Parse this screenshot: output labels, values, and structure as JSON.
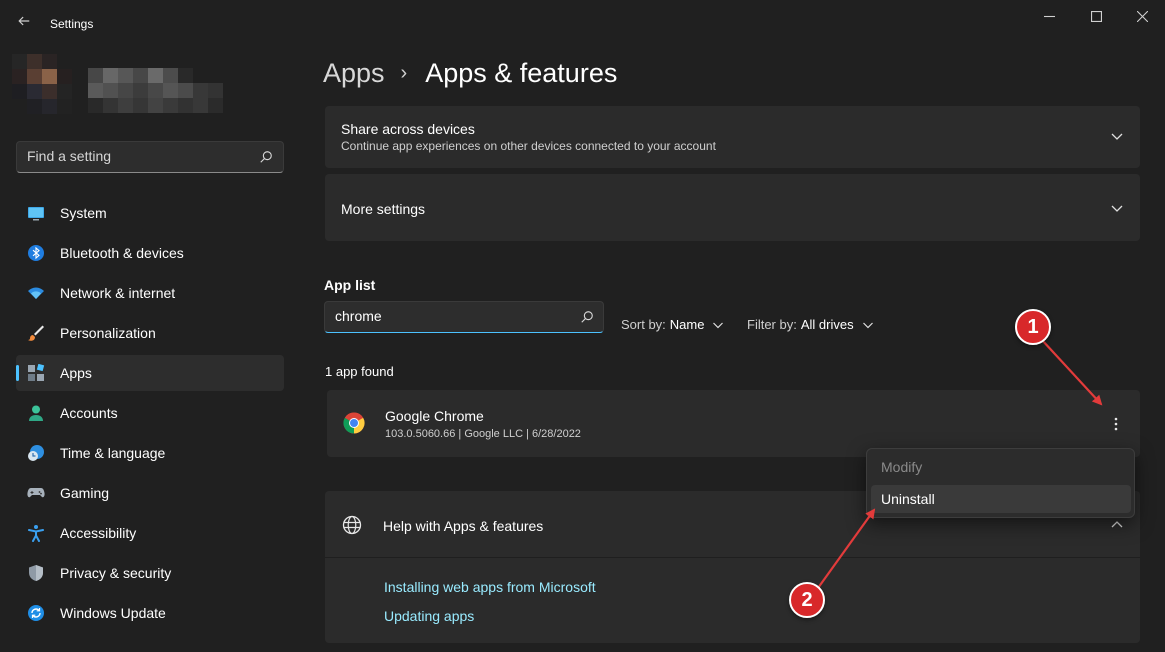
{
  "window": {
    "title": "Settings"
  },
  "search": {
    "placeholder": "Find a setting"
  },
  "sidebar": {
    "items": [
      {
        "label": "System",
        "icon": "monitor-icon"
      },
      {
        "label": "Bluetooth & devices",
        "icon": "bluetooth-icon"
      },
      {
        "label": "Network & internet",
        "icon": "wifi-icon"
      },
      {
        "label": "Personalization",
        "icon": "brush-icon"
      },
      {
        "label": "Apps",
        "icon": "apps-icon",
        "active": true
      },
      {
        "label": "Accounts",
        "icon": "person-icon"
      },
      {
        "label": "Time & language",
        "icon": "clock-globe-icon"
      },
      {
        "label": "Gaming",
        "icon": "gamepad-icon"
      },
      {
        "label": "Accessibility",
        "icon": "accessibility-icon"
      },
      {
        "label": "Privacy & security",
        "icon": "shield-icon"
      },
      {
        "label": "Windows Update",
        "icon": "update-icon"
      }
    ]
  },
  "breadcrumb": {
    "parent": "Apps",
    "current": "Apps & features"
  },
  "cards": {
    "share": {
      "title": "Share across devices",
      "subtitle": "Continue app experiences on other devices connected to your account"
    },
    "more": {
      "title": "More settings"
    }
  },
  "app_list": {
    "label": "App list",
    "search_value": "chrome",
    "sort_label": "Sort by:",
    "sort_value": "Name",
    "filter_label": "Filter by:",
    "filter_value": "All drives",
    "found_text": "1 app found",
    "apps": [
      {
        "name": "Google Chrome",
        "meta": "103.0.5060.66   |   Google LLC   |   6/28/2022"
      }
    ]
  },
  "context_menu": {
    "items": [
      "Modify",
      "Uninstall"
    ]
  },
  "help": {
    "title": "Help with Apps & features",
    "links": [
      "Installing web apps from Microsoft",
      "Updating apps"
    ]
  },
  "annotations": {
    "badge1": "1",
    "badge2": "2"
  },
  "colors": {
    "accent": "#4cc2ff",
    "link": "#99ebff",
    "annotation": "#d8282a",
    "background": "#202020",
    "card": "#2b2b2b"
  }
}
